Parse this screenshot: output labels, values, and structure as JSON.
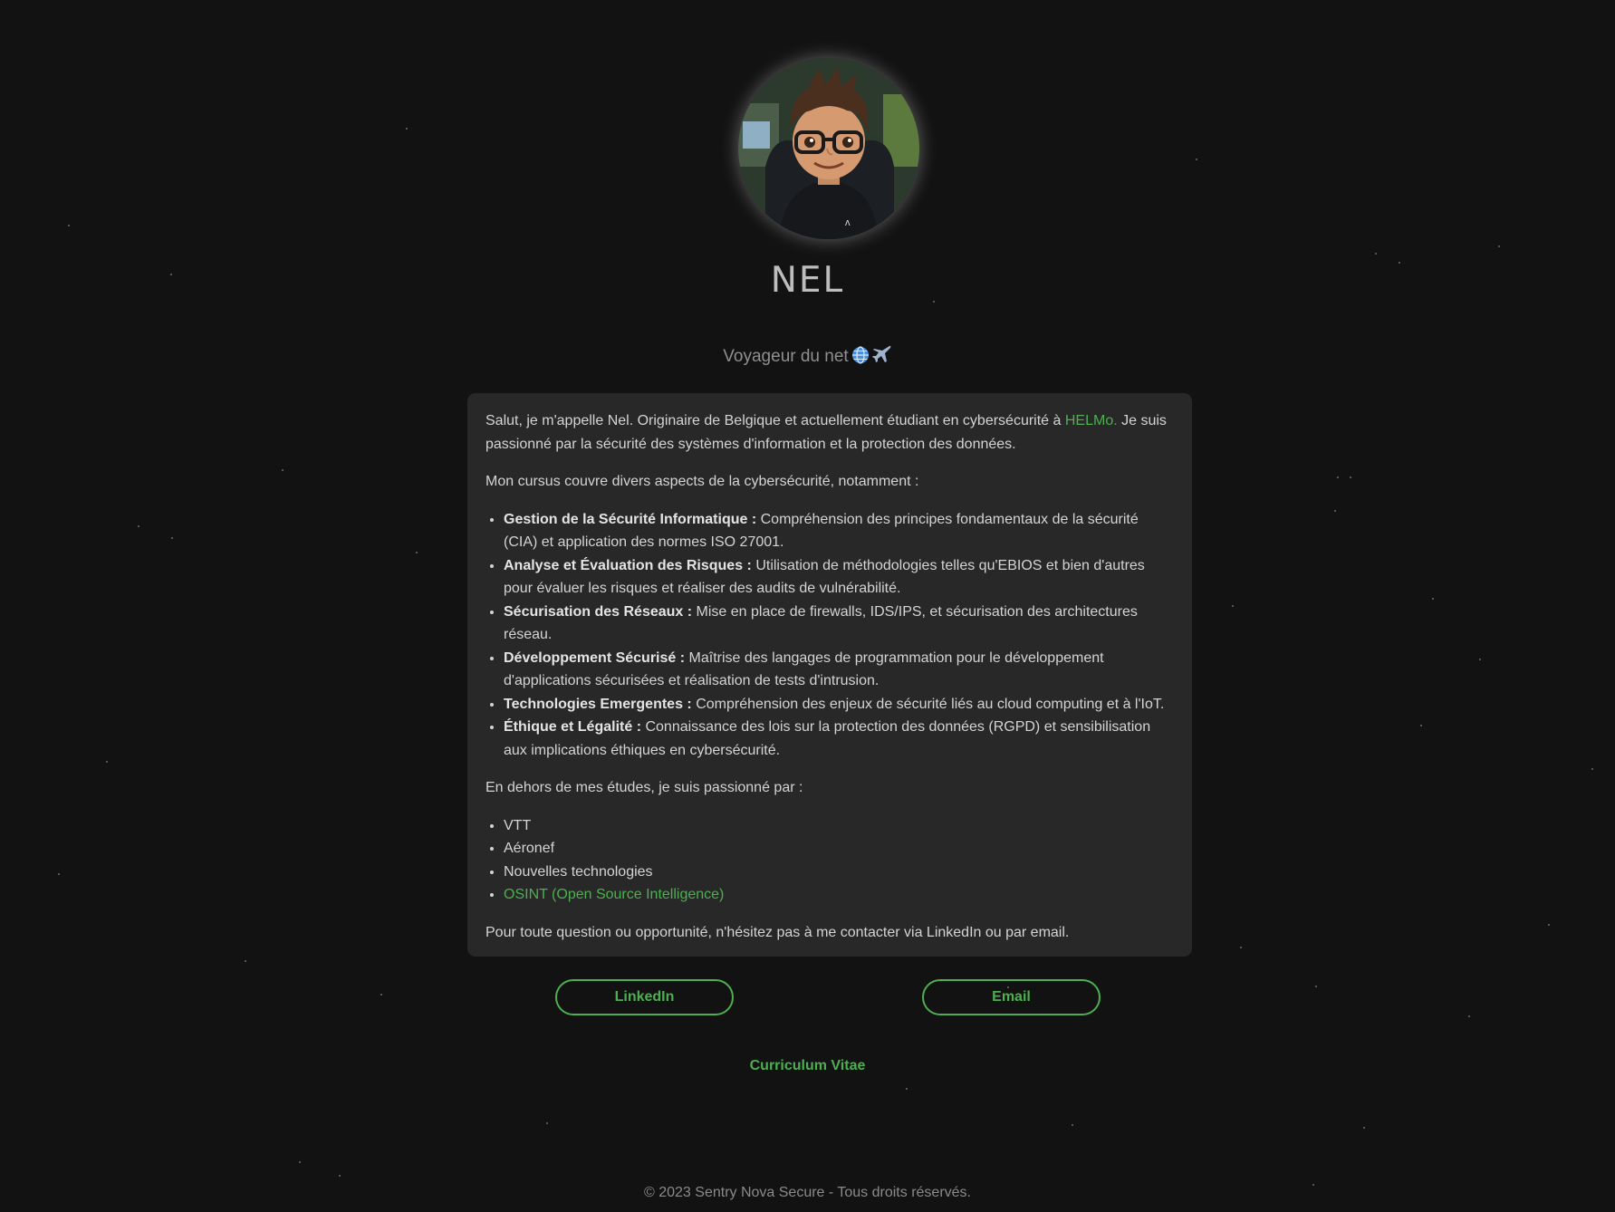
{
  "profile": {
    "name": "NEL",
    "tagline": "Voyageur du net",
    "tagline_icons": [
      "globe-icon",
      "airplane-icon"
    ]
  },
  "about": {
    "intro_before_link": "Salut, je m'appelle Nel. Originaire de Belgique et actuellement étudiant en cybersécurité à ",
    "intro_link": "HELMo.",
    "intro_after_link": " Je suis passionné par la sécurité des systèmes d'information et la protection des données.",
    "curriculum_intro": "Mon cursus couvre divers aspects de la cybersécurité, notamment :",
    "curriculum_items": [
      {
        "title": "Gestion de la Sécurité Informatique :",
        "text": " Compréhension des principes fondamentaux de la sécurité (CIA) et application des normes ISO 27001."
      },
      {
        "title": "Analyse et Évaluation des Risques :",
        "text": " Utilisation de méthodologies telles qu'EBIOS et bien d'autres pour évaluer les risques et réaliser des audits de vulnérabilité."
      },
      {
        "title": "Sécurisation des Réseaux :",
        "text": " Mise en place de firewalls, IDS/IPS, et sécurisation des architectures réseau."
      },
      {
        "title": "Développement Sécurisé :",
        "text": " Maîtrise des langages de programmation pour le développement d'applications sécurisées et réalisation de tests d'intrusion."
      },
      {
        "title": "Technologies Emergentes :",
        "text": " Compréhension des enjeux de sécurité liés au cloud computing et à l'IoT."
      },
      {
        "title": "Éthique et Légalité :",
        "text": " Connaissance des lois sur la protection des données (RGPD) et sensibilisation aux implications éthiques en cybersécurité."
      }
    ],
    "hobbies_intro": "En dehors de mes études, je suis passionné par :",
    "hobbies": [
      "VTT",
      "Aéronef",
      "Nouvelles technologies"
    ],
    "hobby_link": "OSINT (Open Source Intelligence)",
    "contact_text": "Pour toute question ou opportunité, n'hésitez pas à me contacter via LinkedIn ou par email."
  },
  "buttons": {
    "linkedin": "LinkedIn",
    "email": "Email"
  },
  "cv_link": "Curriculum Vitae",
  "footer": "© 2023 Sentry Nova Secure - Tous droits réservés.",
  "colors": {
    "background": "#121212",
    "card": "#282828",
    "accent": "#4caf50",
    "name": "#bdbdbd",
    "muted": "#8a8a8a"
  }
}
